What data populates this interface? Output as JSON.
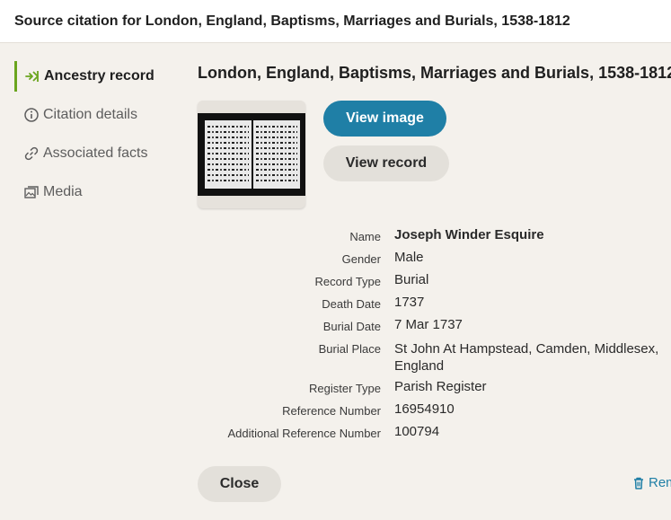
{
  "header": {
    "title": "Source citation for London, England, Baptisms, Marriages and Burials, 1538-1812"
  },
  "sidebar": {
    "items": [
      {
        "label": "Ancestry record",
        "icon": "ancestry-leaf-icon",
        "active": true
      },
      {
        "label": "Citation details",
        "icon": "info-icon"
      },
      {
        "label": "Associated facts",
        "icon": "link-icon"
      },
      {
        "label": "Media",
        "icon": "media-icon"
      }
    ]
  },
  "main": {
    "title": "London, England, Baptisms, Marriages and Burials, 1538-1812",
    "buttons": {
      "view_image": "View image",
      "view_record": "View record"
    },
    "details": [
      {
        "label": "Name",
        "value": "Joseph Winder Esquire"
      },
      {
        "label": "Gender",
        "value": "Male"
      },
      {
        "label": "Record Type",
        "value": "Burial"
      },
      {
        "label": "Death Date",
        "value": "1737"
      },
      {
        "label": "Burial Date",
        "value": "7 Mar 1737"
      },
      {
        "label": "Burial Place",
        "value": "St John At Hampstead, Camden, Middlesex, England"
      },
      {
        "label": "Register Type",
        "value": "Parish Register"
      },
      {
        "label": "Reference Number",
        "value": "16954910"
      },
      {
        "label": "Additional Reference Number",
        "value": "100794"
      }
    ]
  },
  "footer": {
    "close_label": "Close",
    "remove_label": "Rem"
  },
  "colors": {
    "accent_green": "#6aa51e",
    "primary_blue": "#1f7fa6",
    "background": "#f4f1ec"
  }
}
